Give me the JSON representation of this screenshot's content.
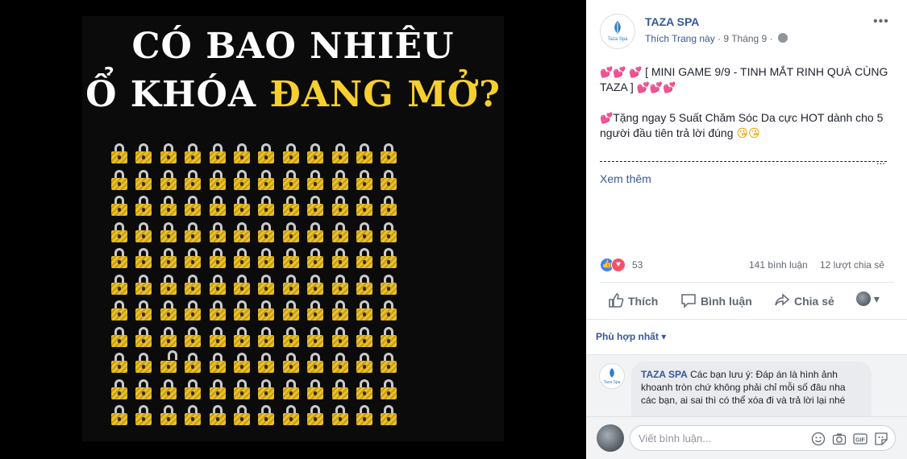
{
  "photo": {
    "headline_line1": "CÓ BAO NHIÊU",
    "headline_line2_prefix": "Ổ KHÓA",
    "headline_line2_highlight": "ĐANG MỞ?",
    "highlight_color": "#f7cf2e"
  },
  "post": {
    "page_name": "TAZA SPA",
    "logo_text": "Taza Spa",
    "like_page": "Thích Trang này",
    "separator": "·",
    "date": "9 Tháng 9",
    "separator2": "·",
    "text1_hearts_before": "💕💕 💕",
    "text1": "[ MINI GAME 9/9 - TINH MẮT RINH QUÀ CÙNG TAZA ]",
    "text1_hearts_after": "💕💕💕",
    "text2_heart": "💕",
    "text2": "Tặng ngay 5 Suất Chăm Sóc Da cực HOT dành cho 5 người đầu tiên trả lời đúng",
    "text2_emoji": "😘😘",
    "dots": "...",
    "see_more": "Xem thêm"
  },
  "stats": {
    "reactions": "53",
    "comments": "141 bình luận",
    "shares": "12 lượt chia sẻ"
  },
  "actions": {
    "like": "Thích",
    "comment": "Bình luận",
    "share": "Chia sẻ"
  },
  "filter": {
    "label": "Phù hợp nhất ▾"
  },
  "comment": {
    "author": "TAZA SPA",
    "text": "Các bạn lưu ý: Đáp án là hình ảnh khoanh tròn chứ không phải chỉ mỗi số đâu nha các bạn, ai sai thì có thể xóa đi và trả lời lại nhé"
  },
  "composer": {
    "placeholder": "Viết bình luận..."
  }
}
